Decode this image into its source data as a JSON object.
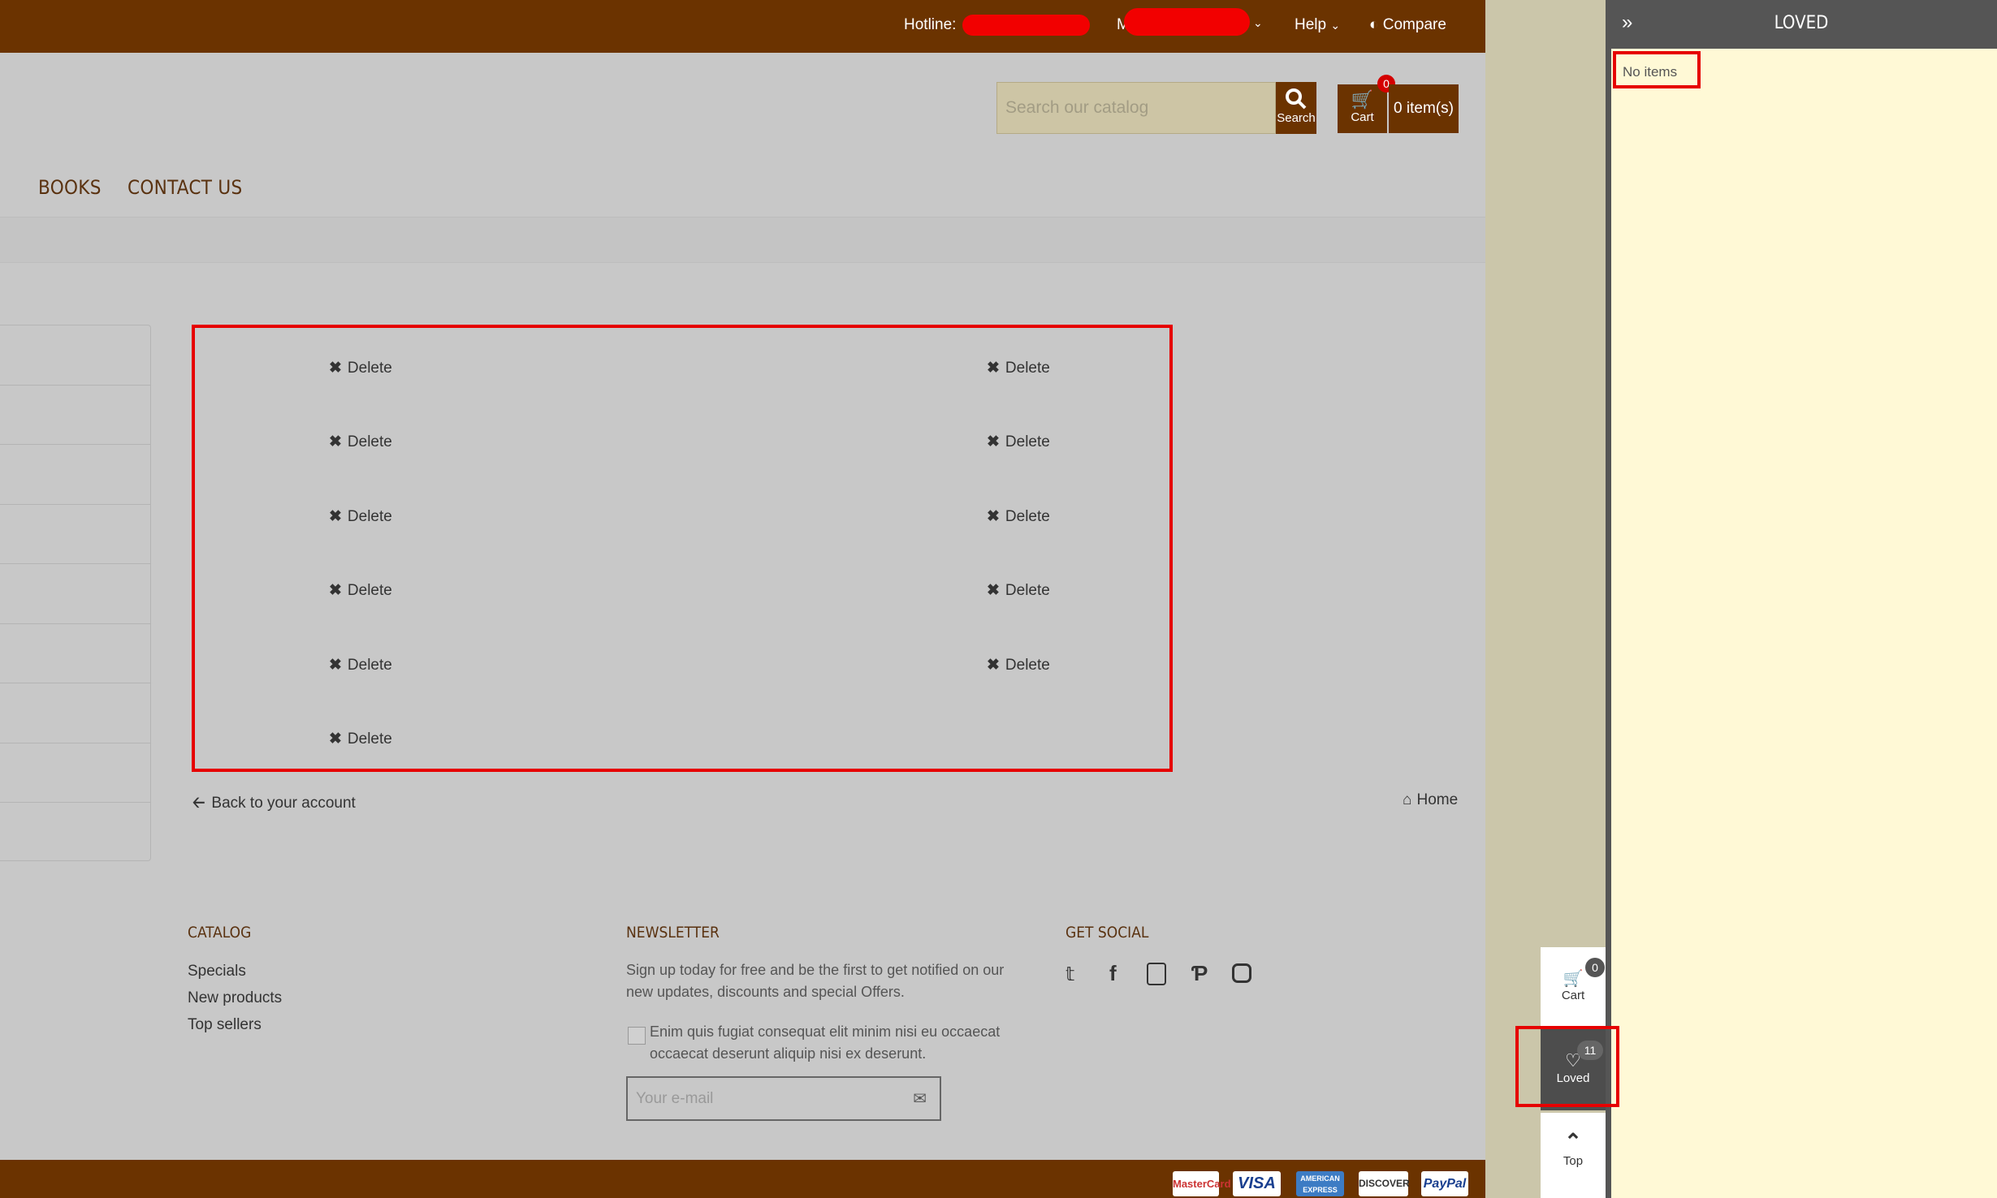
{
  "topbar": {
    "hotline_label": "Hotline:",
    "account_initial": "M",
    "help_label": "Help",
    "compare_label": "Compare"
  },
  "header": {
    "search_placeholder": "Search our catalog",
    "search_label": "Search",
    "cart_label": "Cart",
    "cart_count": "0",
    "cart_items": "0 item(s)"
  },
  "nav": {
    "items": [
      "BOOKS",
      "CONTACT US"
    ]
  },
  "wishlist": {
    "delete_label": "Delete"
  },
  "links": {
    "back": "Back to your account",
    "home": "Home"
  },
  "footer": {
    "catalog_title": "CATALOG",
    "catalog_links": [
      "Specials",
      "New products",
      "Top sellers"
    ],
    "newsletter_title": "NEWSLETTER",
    "newsletter_text": "Sign up today for free and be the first to get notified on our new updates, discounts and special Offers.",
    "consent_text": "Enim quis fugiat consequat elit minim nisi eu occaecat occaecat deserunt aliquip nisi ex deserunt.",
    "email_placeholder": "Your e-mail",
    "social_title": "GET SOCIAL",
    "payments": [
      "MasterCard",
      "VISA",
      "AMERICAN EXPRESS",
      "DISCOVER",
      "PayPal"
    ]
  },
  "panel": {
    "title": "LOVED",
    "empty_text": "No items"
  },
  "side": {
    "cart_label": "Cart",
    "cart_count": "0",
    "loved_label": "Loved",
    "loved_count": "11",
    "top_label": "Top"
  },
  "colors": {
    "brand": "#6b3300",
    "highlight": "#e60000",
    "panel_bg": "#fff9d6"
  }
}
